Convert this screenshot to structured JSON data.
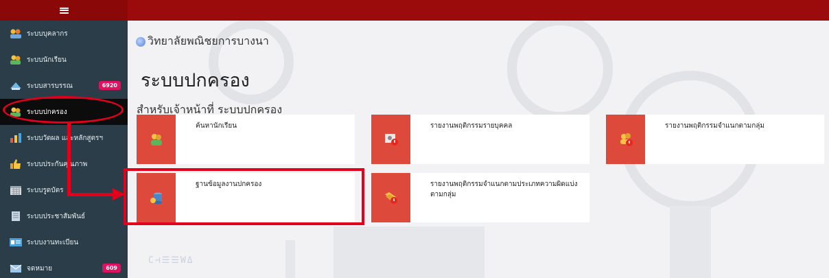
{
  "sidebar": {
    "items": [
      {
        "label": "ระบบบุคลากร",
        "icon": "staff-icon"
      },
      {
        "label": "ระบบนักเรียน",
        "icon": "students-icon"
      },
      {
        "label": "ระบบสารบรรณ",
        "icon": "document-icon",
        "badge": "6920"
      },
      {
        "label": "ระบบปกครอง",
        "icon": "governance-icon",
        "active": true
      },
      {
        "label": "ระบบวัดผล และหลักสูตรฯ",
        "icon": "chart-icon"
      },
      {
        "label": "ระบบประกันคุณภาพ",
        "icon": "thumbs-up-icon"
      },
      {
        "label": "ระบบรูดบัตร",
        "icon": "calendar-icon"
      },
      {
        "label": "ระบบประชาสัมพันธ์",
        "icon": "notebook-icon"
      },
      {
        "label": "ระบบงานทะเบียน",
        "icon": "id-card-icon"
      },
      {
        "label": "จดหมาย",
        "icon": "mail-icon",
        "badge": "609"
      }
    ]
  },
  "header": {
    "college_name": "วิทยาลัยพณิชยการบางนา",
    "page_title": "ระบบปกครอง",
    "subtitle": "สำหรับเจ้าหน้าที่ ระบบปกครอง"
  },
  "cards": [
    {
      "label": "ค้นหานักเรียน"
    },
    {
      "label": "รายงานพฤติกรรมรายบุคคล"
    },
    {
      "label": "รายงานพฤติกรรมจำแนกตามกลุ่ม"
    },
    {
      "label": "ฐานข้อมูลงานปกครอง"
    },
    {
      "label": "รายงานพฤติกรรมจำแนกตามประเภทความผิดแบ่งตามกลุ่ม"
    }
  ],
  "watermark": "C⊣☰☰WΔ",
  "colors": {
    "topbar": "#9b0b0b",
    "sidebar": "#2a3d48",
    "card_icon": "#dd4a3b",
    "highlight": "#e3001b"
  }
}
